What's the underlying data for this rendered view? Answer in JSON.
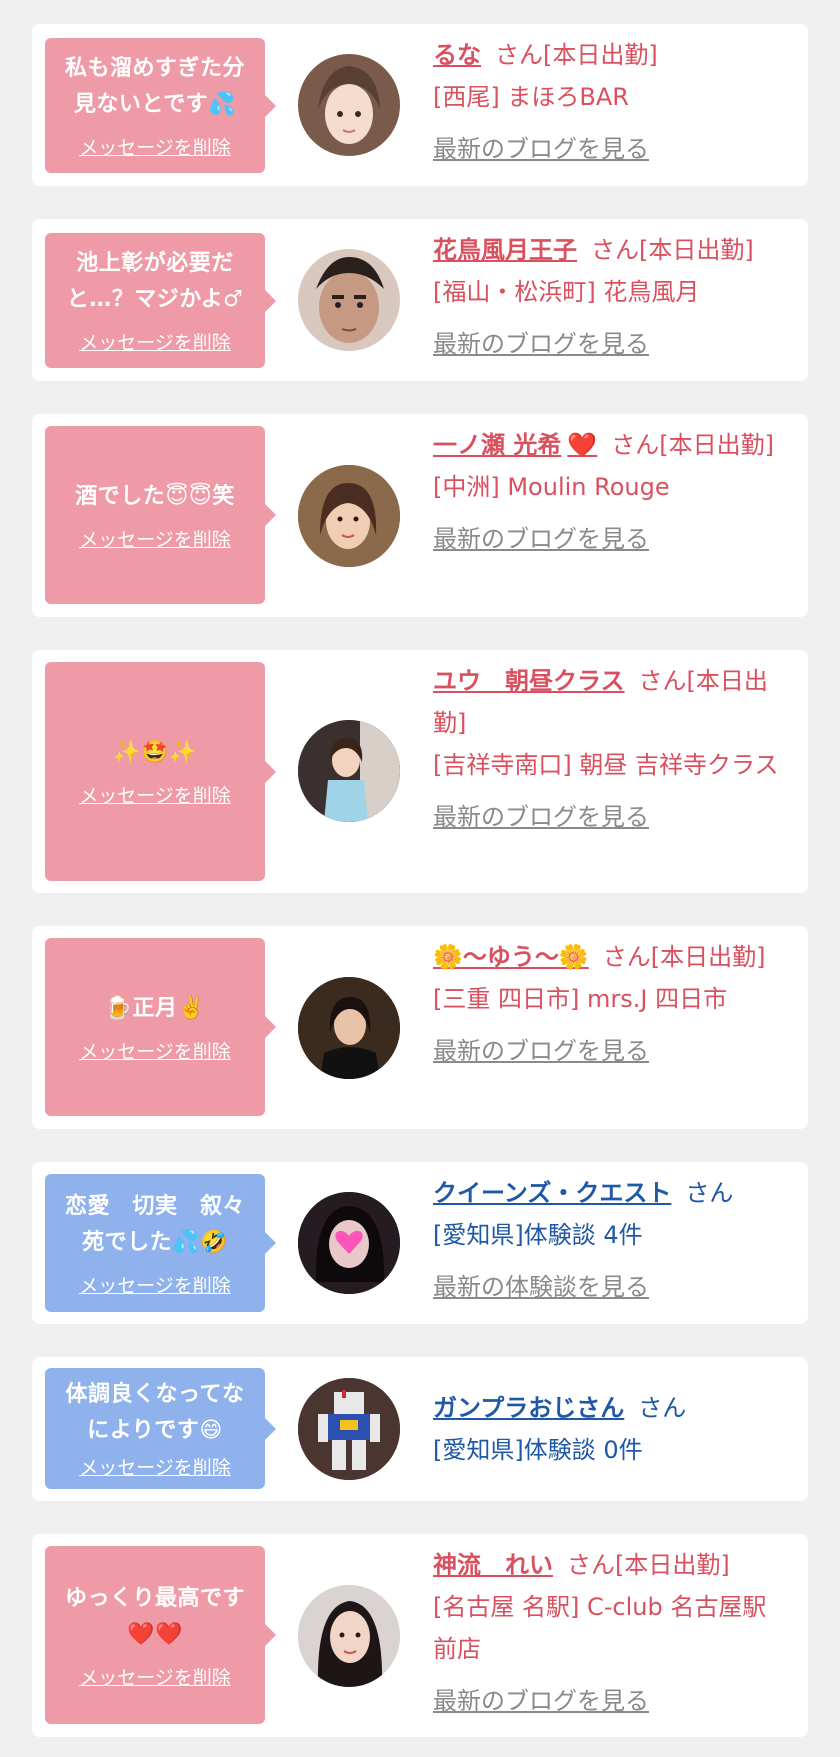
{
  "delete_label": "メッセージを削除",
  "blog_link": "最新のブログを見る",
  "review_link": "最新の体験談を見る",
  "honorific": "さん",
  "cards": [
    {
      "type": "girl",
      "message_l1": "私も溜めすぎた分",
      "message_l2": "見ないとです",
      "message_emoji": "💦",
      "name": "るな",
      "status": "[本日出勤]",
      "location": "[西尾] まほろBAR"
    },
    {
      "type": "girl",
      "message_l1": "池上彰が必要だ",
      "message_l2": "と…？マジかよ♂",
      "name": "花鳥風月王子",
      "status": "[本日出勤]",
      "location": "[福山・松浜町] 花鳥風月"
    },
    {
      "type": "girl",
      "message_l1": "酒でした",
      "message_emoji": "😇😇",
      "message_tail": "笑",
      "name": "一ノ瀬 光希",
      "name_icon": "❤️",
      "status": "[本日出勤]",
      "location": "[中洲] Moulin Rouge"
    },
    {
      "type": "girl",
      "message_emoji": "✨🤩✨",
      "name": "ユウ　朝昼クラス",
      "status": "[本日出勤]",
      "location": "[吉祥寺南口] 朝昼 吉祥寺クラス"
    },
    {
      "type": "girl",
      "message_emoji_pre": "🍺",
      "message_l1": "正月",
      "message_emoji": "✌️",
      "name": "〜ゆう〜",
      "name_icon": "🌼",
      "status": "[本日出勤]",
      "location": "[三重 四日市] mrs.J 四日市"
    },
    {
      "type": "reviewer",
      "message_l1": "恋愛　切実　叙々",
      "message_l2": "苑でした",
      "message_emoji": "💦🤣",
      "name": "クイーンズ・クエスト",
      "location": "[愛知県]体験談 4件"
    },
    {
      "type": "reviewer",
      "message_l1": "体調良くなってな",
      "message_l2": "によりです",
      "message_emoji": "😄",
      "name": "ガンプラおじさん",
      "location": "[愛知県]体験談 0件"
    },
    {
      "type": "girl",
      "message_l1": "ゆっくり最高です",
      "message_l2": "",
      "message_emoji": "❤️❤️",
      "name": "神流　れい",
      "status": "[本日出勤]",
      "location": "[名古屋 名駅] C-club 名古屋駅前店"
    }
  ],
  "colors": {
    "pink_bubble": "#ee9aa7",
    "blue_bubble": "#8fb2ec",
    "pink_text": "#d9505f",
    "blue_text": "#1f58a5",
    "link_gray": "#8a8a8a"
  }
}
